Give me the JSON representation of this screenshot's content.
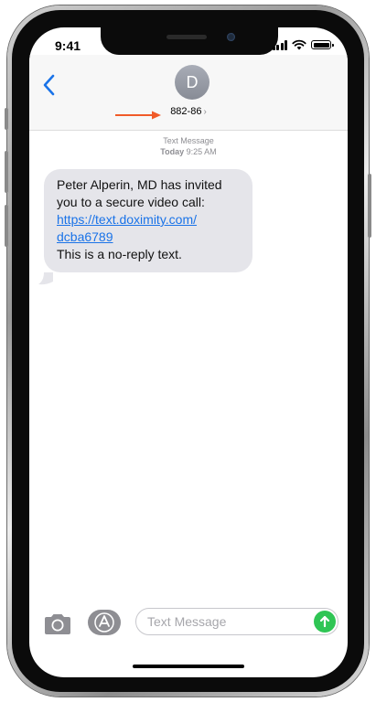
{
  "status_bar": {
    "time": "9:41"
  },
  "header": {
    "back_icon": "chevron-left-icon",
    "avatar_initial": "D",
    "contact_number": "882-86",
    "contact_chevron": "›"
  },
  "thread": {
    "meta_label": "Text Message",
    "meta_day": "Today",
    "meta_time": "9:25 AM",
    "message": {
      "line1": "Peter Alperin, MD has invited",
      "line2": "you to a secure video call:",
      "link_line1": "https://text.doximity.com/",
      "link_line2": "dcba6789",
      "line3": "This is a no-reply text."
    }
  },
  "compose": {
    "placeholder": "Text Message",
    "camera_icon": "camera-icon",
    "apps_icon": "app-store-icon",
    "send_icon": "send-arrow-icon"
  },
  "colors": {
    "accent": "#1a73e8",
    "bubble": "#e5e5ea",
    "send": "#2fc554",
    "annotation_arrow": "#f05a28"
  }
}
